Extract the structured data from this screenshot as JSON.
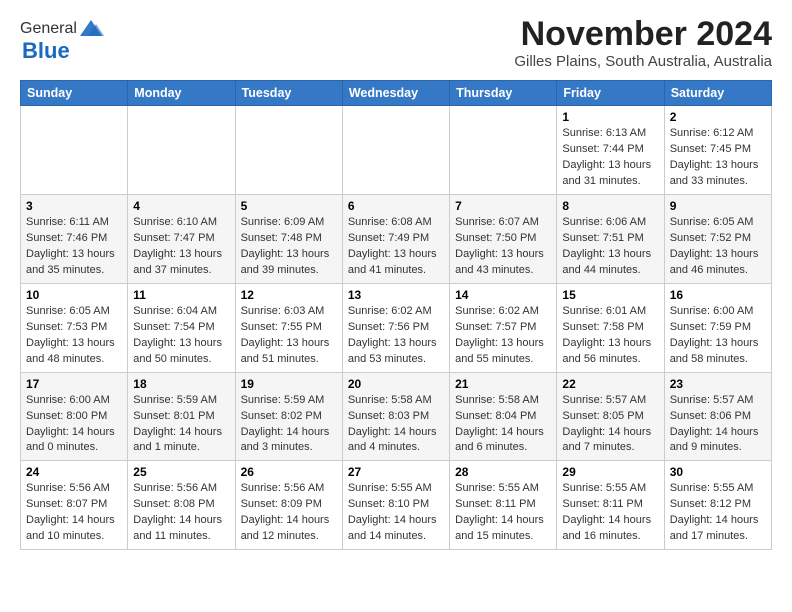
{
  "logo": {
    "general": "General",
    "blue": "Blue"
  },
  "title": "November 2024",
  "subtitle": "Gilles Plains, South Australia, Australia",
  "headers": [
    "Sunday",
    "Monday",
    "Tuesday",
    "Wednesday",
    "Thursday",
    "Friday",
    "Saturday"
  ],
  "weeks": [
    [
      {
        "num": "",
        "info": ""
      },
      {
        "num": "",
        "info": ""
      },
      {
        "num": "",
        "info": ""
      },
      {
        "num": "",
        "info": ""
      },
      {
        "num": "",
        "info": ""
      },
      {
        "num": "1",
        "info": "Sunrise: 6:13 AM\nSunset: 7:44 PM\nDaylight: 13 hours\nand 31 minutes."
      },
      {
        "num": "2",
        "info": "Sunrise: 6:12 AM\nSunset: 7:45 PM\nDaylight: 13 hours\nand 33 minutes."
      }
    ],
    [
      {
        "num": "3",
        "info": "Sunrise: 6:11 AM\nSunset: 7:46 PM\nDaylight: 13 hours\nand 35 minutes."
      },
      {
        "num": "4",
        "info": "Sunrise: 6:10 AM\nSunset: 7:47 PM\nDaylight: 13 hours\nand 37 minutes."
      },
      {
        "num": "5",
        "info": "Sunrise: 6:09 AM\nSunset: 7:48 PM\nDaylight: 13 hours\nand 39 minutes."
      },
      {
        "num": "6",
        "info": "Sunrise: 6:08 AM\nSunset: 7:49 PM\nDaylight: 13 hours\nand 41 minutes."
      },
      {
        "num": "7",
        "info": "Sunrise: 6:07 AM\nSunset: 7:50 PM\nDaylight: 13 hours\nand 43 minutes."
      },
      {
        "num": "8",
        "info": "Sunrise: 6:06 AM\nSunset: 7:51 PM\nDaylight: 13 hours\nand 44 minutes."
      },
      {
        "num": "9",
        "info": "Sunrise: 6:05 AM\nSunset: 7:52 PM\nDaylight: 13 hours\nand 46 minutes."
      }
    ],
    [
      {
        "num": "10",
        "info": "Sunrise: 6:05 AM\nSunset: 7:53 PM\nDaylight: 13 hours\nand 48 minutes."
      },
      {
        "num": "11",
        "info": "Sunrise: 6:04 AM\nSunset: 7:54 PM\nDaylight: 13 hours\nand 50 minutes."
      },
      {
        "num": "12",
        "info": "Sunrise: 6:03 AM\nSunset: 7:55 PM\nDaylight: 13 hours\nand 51 minutes."
      },
      {
        "num": "13",
        "info": "Sunrise: 6:02 AM\nSunset: 7:56 PM\nDaylight: 13 hours\nand 53 minutes."
      },
      {
        "num": "14",
        "info": "Sunrise: 6:02 AM\nSunset: 7:57 PM\nDaylight: 13 hours\nand 55 minutes."
      },
      {
        "num": "15",
        "info": "Sunrise: 6:01 AM\nSunset: 7:58 PM\nDaylight: 13 hours\nand 56 minutes."
      },
      {
        "num": "16",
        "info": "Sunrise: 6:00 AM\nSunset: 7:59 PM\nDaylight: 13 hours\nand 58 minutes."
      }
    ],
    [
      {
        "num": "17",
        "info": "Sunrise: 6:00 AM\nSunset: 8:00 PM\nDaylight: 14 hours\nand 0 minutes."
      },
      {
        "num": "18",
        "info": "Sunrise: 5:59 AM\nSunset: 8:01 PM\nDaylight: 14 hours\nand 1 minute."
      },
      {
        "num": "19",
        "info": "Sunrise: 5:59 AM\nSunset: 8:02 PM\nDaylight: 14 hours\nand 3 minutes."
      },
      {
        "num": "20",
        "info": "Sunrise: 5:58 AM\nSunset: 8:03 PM\nDaylight: 14 hours\nand 4 minutes."
      },
      {
        "num": "21",
        "info": "Sunrise: 5:58 AM\nSunset: 8:04 PM\nDaylight: 14 hours\nand 6 minutes."
      },
      {
        "num": "22",
        "info": "Sunrise: 5:57 AM\nSunset: 8:05 PM\nDaylight: 14 hours\nand 7 minutes."
      },
      {
        "num": "23",
        "info": "Sunrise: 5:57 AM\nSunset: 8:06 PM\nDaylight: 14 hours\nand 9 minutes."
      }
    ],
    [
      {
        "num": "24",
        "info": "Sunrise: 5:56 AM\nSunset: 8:07 PM\nDaylight: 14 hours\nand 10 minutes."
      },
      {
        "num": "25",
        "info": "Sunrise: 5:56 AM\nSunset: 8:08 PM\nDaylight: 14 hours\nand 11 minutes."
      },
      {
        "num": "26",
        "info": "Sunrise: 5:56 AM\nSunset: 8:09 PM\nDaylight: 14 hours\nand 12 minutes."
      },
      {
        "num": "27",
        "info": "Sunrise: 5:55 AM\nSunset: 8:10 PM\nDaylight: 14 hours\nand 14 minutes."
      },
      {
        "num": "28",
        "info": "Sunrise: 5:55 AM\nSunset: 8:11 PM\nDaylight: 14 hours\nand 15 minutes."
      },
      {
        "num": "29",
        "info": "Sunrise: 5:55 AM\nSunset: 8:11 PM\nDaylight: 14 hours\nand 16 minutes."
      },
      {
        "num": "30",
        "info": "Sunrise: 5:55 AM\nSunset: 8:12 PM\nDaylight: 14 hours\nand 17 minutes."
      }
    ]
  ]
}
